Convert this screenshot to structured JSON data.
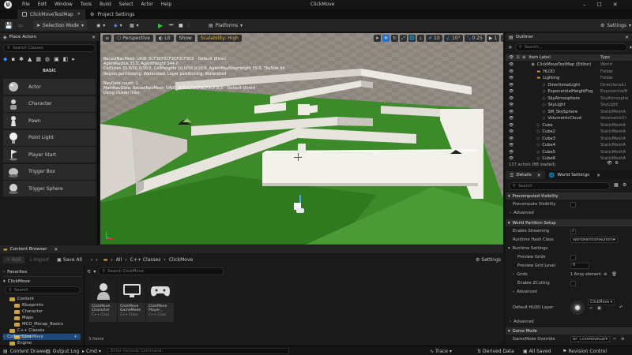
{
  "menu": [
    "File",
    "Edit",
    "Window",
    "Tools",
    "Build",
    "Select",
    "Actor",
    "Help"
  ],
  "window_title": "ClickMove",
  "tabs": [
    {
      "label": "ClickMoveTestMap"
    },
    {
      "label": "Project Settings"
    }
  ],
  "toolbar": {
    "mode": "Selection Mode",
    "platforms": "Platforms",
    "settings": "Settings"
  },
  "place_actors": {
    "title": "Place Actors",
    "search_placeholder": "Search Classes",
    "category": "BASIC",
    "items": [
      "Actor",
      "Character",
      "Pawn",
      "Point Light",
      "Player Start",
      "Trigger Box",
      "Trigger Sphere"
    ]
  },
  "viewport": {
    "view_mode": "Perspective",
    "lit": "Lit",
    "show": "Show",
    "scalability": "Scalability: High",
    "grid_snap": "10",
    "rot_snap": "10°",
    "scale_snap": "0.25",
    "cam_speed": "1",
    "overlay_lines": [
      "RecastNavMesh_UAID_3CF3CF3CF3CF3CF3C0 - Default (Error)",
      "AgentRadius 35.0, AgentHeight 144.0",
      "CellSizes 30.0/10.0/10.0, CellHeights 10.0/10.0/10.0, AgentMaxStepHeight 35.0, TileSize 64",
      "Region partitioning: Watershed, Layer partitioning: Watershed",
      "",
      "NavData count: 1",
      "MainNavData: RecastNavMesh_UAID_3CF3CF3CF3CF3CF3C0 - Default (Error)",
      "Using cluster links"
    ]
  },
  "outliner": {
    "title": "Outliner",
    "search_placeholder": "Search...",
    "col_label": "Item Label",
    "col_type": "Type",
    "rows": [
      {
        "label": "ClickMoveTestMap (Editor)",
        "type": "World",
        "indent": 0
      },
      {
        "label": "HLOD",
        "type": "Folder",
        "indent": 1
      },
      {
        "label": "Lighting",
        "type": "Folder",
        "indent": 1
      },
      {
        "label": "DirectionalLight",
        "type": "DirectionalLi",
        "indent": 2
      },
      {
        "label": "ExponentialHeightFog",
        "type": "ExponentialH",
        "indent": 2
      },
      {
        "label": "SkyAtmosphere",
        "type": "SkyAtmosphe",
        "indent": 2
      },
      {
        "label": "SkyLight",
        "type": "SkyLight",
        "indent": 2
      },
      {
        "label": "SM_SkySphere",
        "type": "StaticMeshA",
        "indent": 2
      },
      {
        "label": "VolumetricCloud",
        "type": "VolumetricCl",
        "indent": 2
      },
      {
        "label": "Cube",
        "type": "StaticMeshA",
        "indent": 1
      },
      {
        "label": "Cube2",
        "type": "StaticMeshA",
        "indent": 1
      },
      {
        "label": "Cube3",
        "type": "StaticMeshA",
        "indent": 1
      },
      {
        "label": "Cube4",
        "type": "StaticMeshA",
        "indent": 1
      },
      {
        "label": "Cube5",
        "type": "StaticMeshA",
        "indent": 1
      },
      {
        "label": "Cube6",
        "type": "StaticMeshA",
        "indent": 1
      }
    ],
    "footer": "137 actors (88 loaded)"
  },
  "details": {
    "tabs": [
      "Details",
      "World Settings"
    ],
    "search_placeholder": "Search",
    "sections": {
      "precomputed_visibility": "Precomputed Visibility",
      "precompute_visibility": "Precompute Visibility",
      "advanced": "Advanced",
      "world_partition_setup": "World Partition Setup",
      "enable_streaming": "Enable Streaming",
      "runtime_hash_class": "Runtime Hash Class",
      "runtime_hash_value": "WorldPartitionRuntime",
      "runtime_settings": "Runtime Settings",
      "preview_grids": "Preview Grids",
      "preview_grid_level": "Preview Grid Level",
      "preview_grid_level_value": "0",
      "grids": "Grids",
      "grids_value": "1 Array element",
      "enable_zculling": "Enable ZCulling",
      "advanced2": "Advanced",
      "default_hlod_layer": "Default HLOD Layer",
      "hlod_value": "ClickMove",
      "advanced3": "Advanced",
      "game_mode": "Game Mode",
      "game_mode_override": "GameMode Override",
      "game_mode_override_value": "BP_ClickMoveGar"
    }
  },
  "content_browser": {
    "title": "Content Browser",
    "add": "+ Add",
    "import": "Import",
    "save_all": "Save All",
    "breadcrumb": [
      "All",
      "C++ Classes",
      "ClickMove"
    ],
    "settings": "Settings",
    "favorites": "Favorites",
    "project": "ClickMove",
    "tree_search": "Search",
    "search_placeholder": "Search ClickMove",
    "tree": [
      {
        "label": "Content",
        "indent": 0
      },
      {
        "label": "Blueprints",
        "indent": 1
      },
      {
        "label": "Character",
        "indent": 1
      },
      {
        "label": "Maps",
        "indent": 1
      },
      {
        "label": "MCO_Mocap_Basics",
        "indent": 1
      },
      {
        "label": "C++ Classes",
        "indent": 0
      },
      {
        "label": "ClickMove",
        "indent": 1
      },
      {
        "label": "Engine",
        "indent": 0
      }
    ],
    "assets": [
      {
        "name": "ClickMove Character",
        "sub": "C++ Class"
      },
      {
        "name": "ClickMove GameMode",
        "sub": "C++ Class"
      },
      {
        "name": "ClickMove Player...",
        "sub": "C++ Class"
      }
    ],
    "item_count": "3 items",
    "collections": "Collections"
  },
  "status": {
    "content_drawer": "Content Drawer",
    "output_log": "Output Log",
    "cmd": "Cmd",
    "console_placeholder": "Enter Console Command",
    "trace": "Trace",
    "derived_data": "Derived Data",
    "all_saved": "All Saved",
    "revision_control": "Revision Control"
  }
}
